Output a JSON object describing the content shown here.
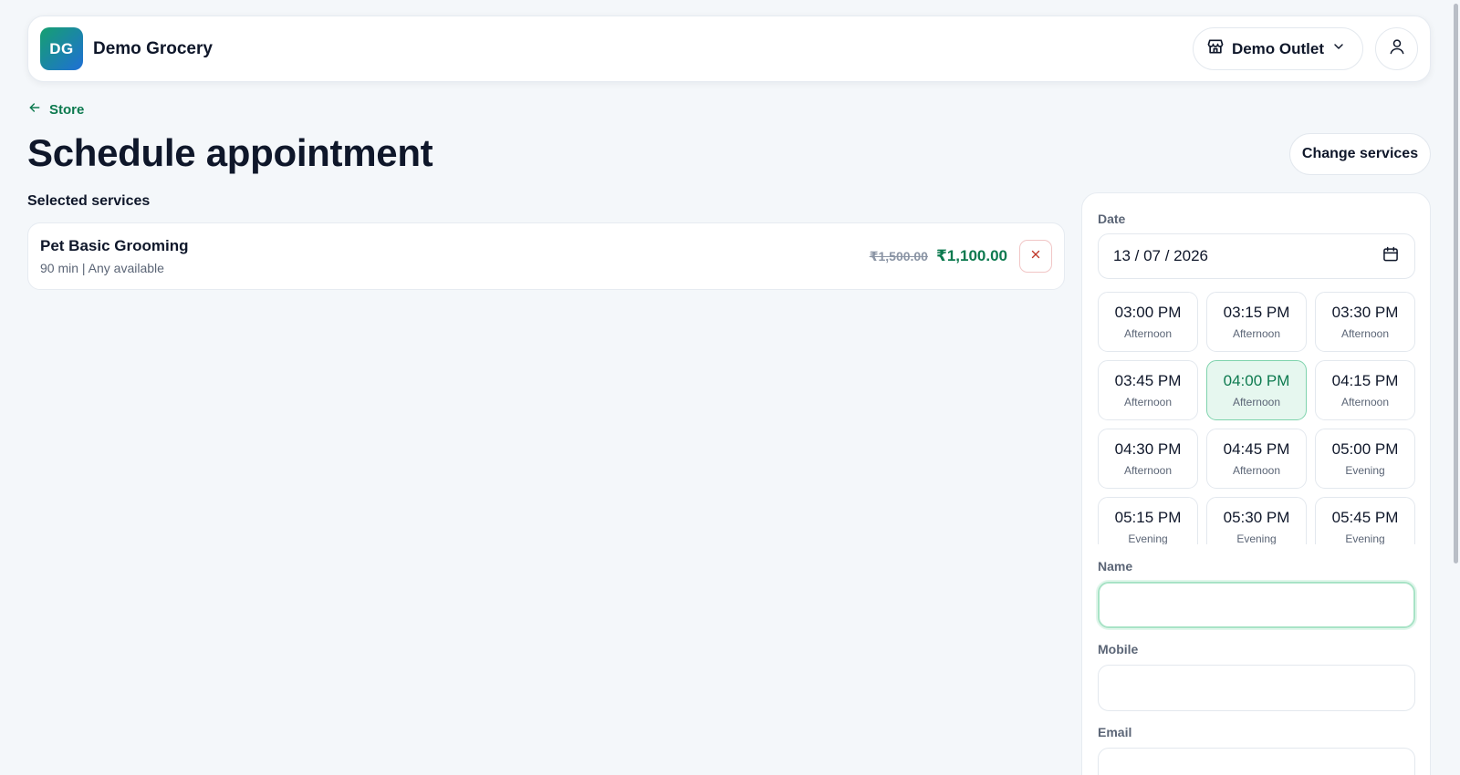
{
  "header": {
    "logo_initials": "DG",
    "brand_name": "Demo Grocery",
    "outlet_label": "Demo Outlet",
    "outlet_icon": "store-icon",
    "account_icon": "user-icon"
  },
  "nav": {
    "back_label": "Store",
    "back_icon": "arrow-left-icon"
  },
  "page": {
    "title": "Schedule appointment",
    "change_services_label": "Change services",
    "selected_services_label": "Selected services"
  },
  "services": [
    {
      "name": "Pet Basic Grooming",
      "meta": "90 min | Any available",
      "price_original": "₹1,500.00",
      "price_current": "₹1,100.00"
    }
  ],
  "booking": {
    "date_label": "Date",
    "date_value": "13 / 07 / 2026",
    "slots": [
      {
        "time": "03:00 PM",
        "period": "Afternoon",
        "selected": false
      },
      {
        "time": "03:15 PM",
        "period": "Afternoon",
        "selected": false
      },
      {
        "time": "03:30 PM",
        "period": "Afternoon",
        "selected": false
      },
      {
        "time": "03:45 PM",
        "period": "Afternoon",
        "selected": false
      },
      {
        "time": "04:00 PM",
        "period": "Afternoon",
        "selected": true
      },
      {
        "time": "04:15 PM",
        "period": "Afternoon",
        "selected": false
      },
      {
        "time": "04:30 PM",
        "period": "Afternoon",
        "selected": false
      },
      {
        "time": "04:45 PM",
        "period": "Afternoon",
        "selected": false
      },
      {
        "time": "05:00 PM",
        "period": "Evening",
        "selected": false
      },
      {
        "time": "05:15 PM",
        "period": "Evening",
        "selected": false
      },
      {
        "time": "05:30 PM",
        "period": "Evening",
        "selected": false
      },
      {
        "time": "05:45 PM",
        "period": "Evening",
        "selected": false
      }
    ],
    "name_label": "Name",
    "name_value": "",
    "mobile_label": "Mobile",
    "mobile_value": "",
    "email_label": "Email",
    "email_value": ""
  },
  "colors": {
    "accent": "#0d7a4f",
    "background": "#f4f7fa",
    "selected_slot_bg": "#e6f7ef",
    "remove_icon": "#c0392b"
  }
}
